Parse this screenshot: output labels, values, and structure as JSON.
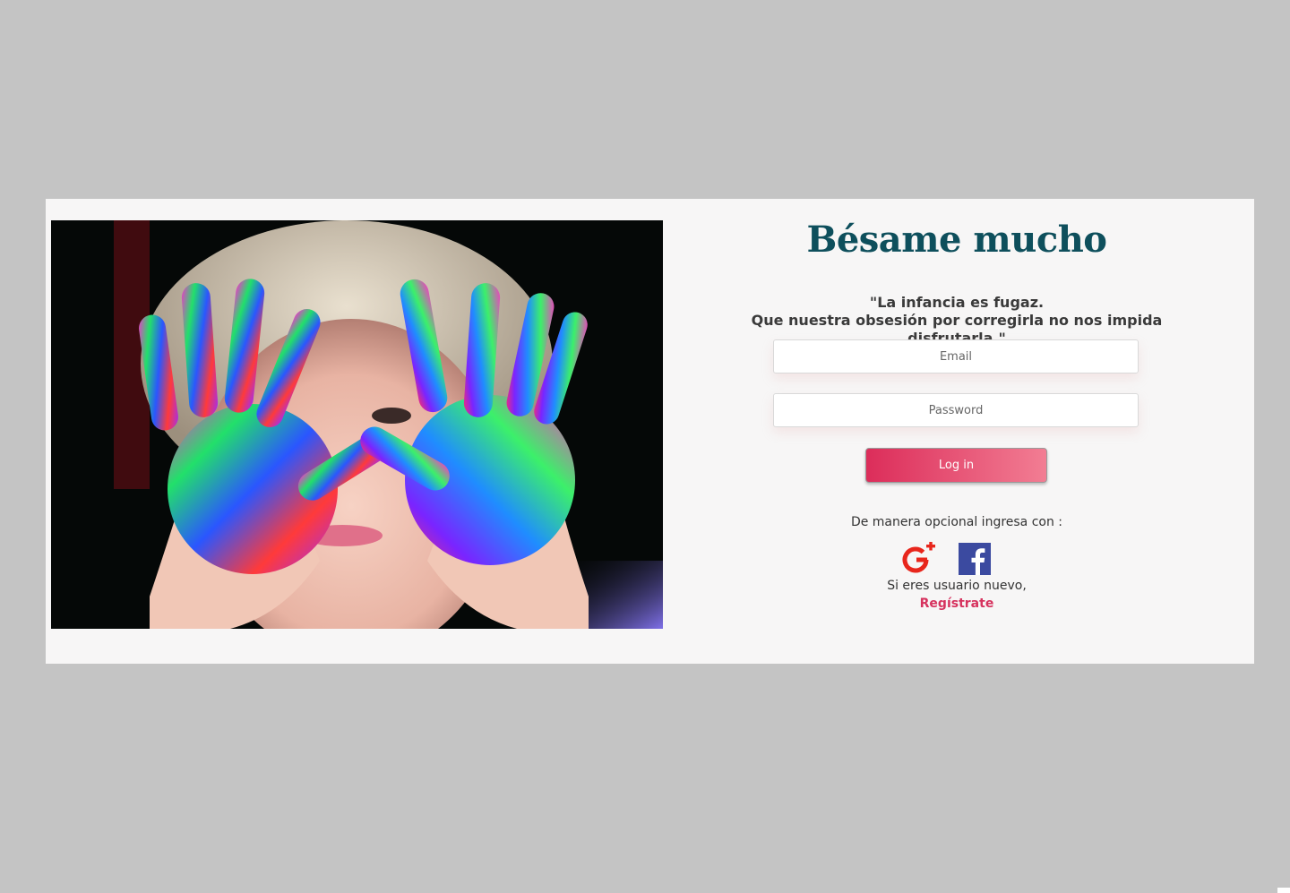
{
  "brand": {
    "title": "Bésame mucho"
  },
  "quote": {
    "line1": "\"La infancia es fugaz.",
    "line2": "Que nuestra obsesión por corregirla no nos impida disfrutarla.\""
  },
  "form": {
    "email_placeholder": "Email",
    "password_placeholder": "Password",
    "login_label": "Log in"
  },
  "social": {
    "prompt": "De manera opcional ingresa con :",
    "google_icon": "google-plus-icon",
    "facebook_icon": "facebook-icon"
  },
  "register": {
    "prompt": "Si eres usuario nuevo,",
    "link_label": "Regístrate"
  },
  "colors": {
    "brand": "#0e4f5c",
    "accent": "#d6325e",
    "button_start": "#dc2d5a",
    "button_end": "#f27d93",
    "facebook": "#3b4aa0",
    "google": "#e8261c",
    "page_bg": "#c4c4c4",
    "card_bg": "#f7f6f6"
  }
}
